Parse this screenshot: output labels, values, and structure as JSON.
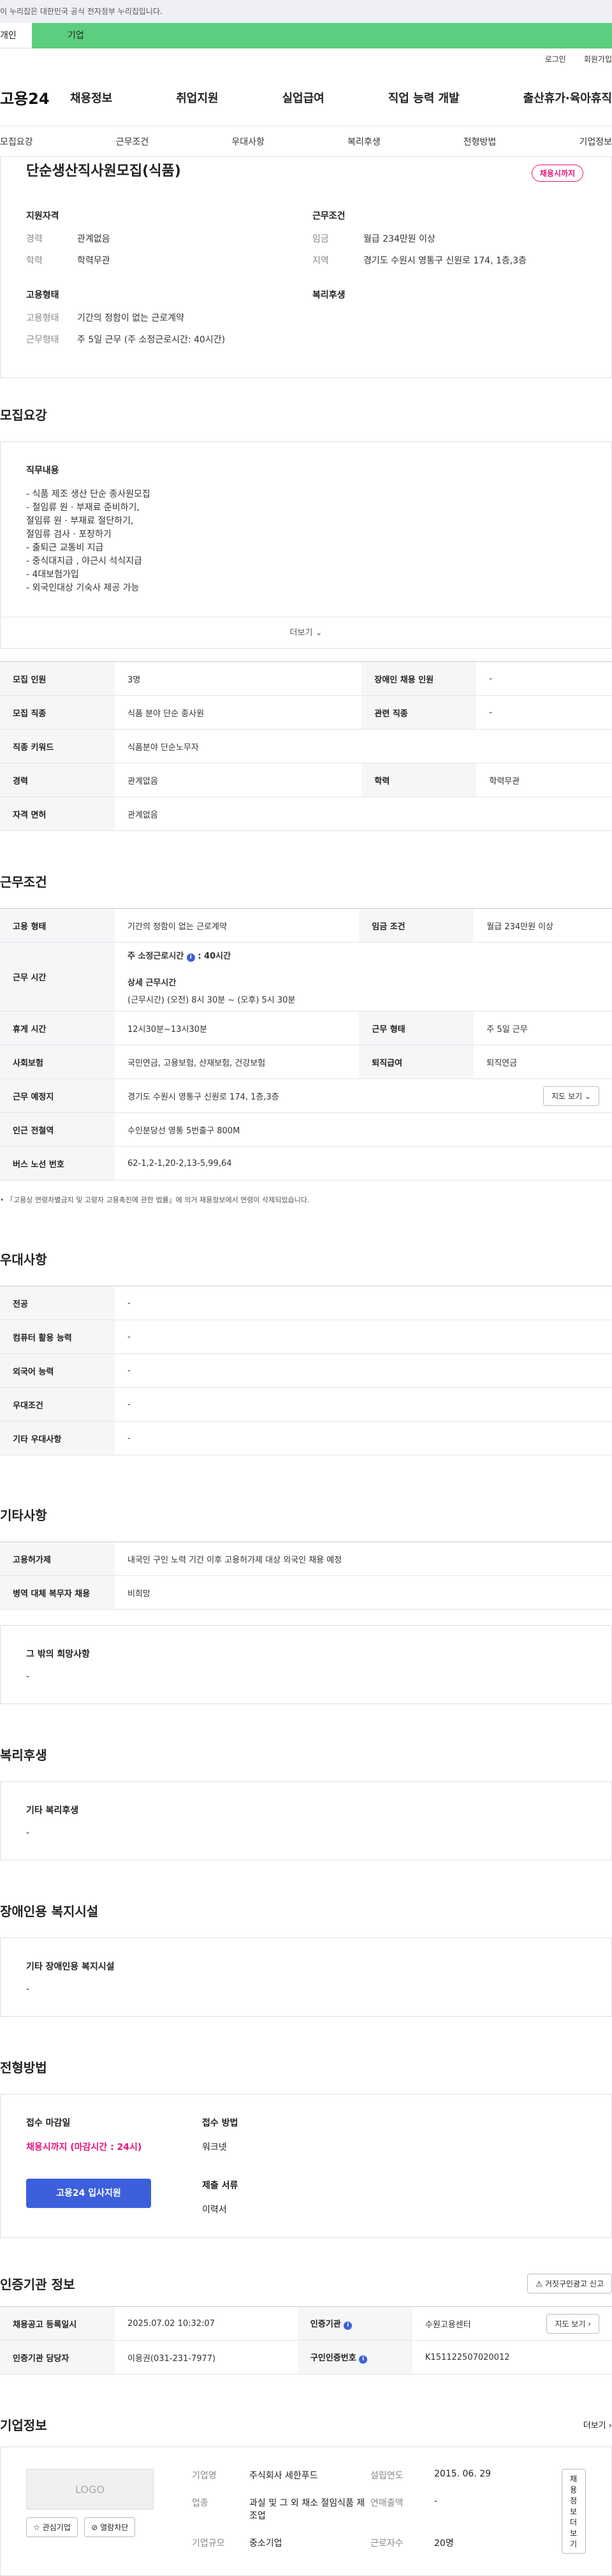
{
  "gov_banner": "이 누리집은 대한민국 공식 전자정부 누리집입니다.",
  "top_tabs": {
    "personal": "개인",
    "company": "기업"
  },
  "util": {
    "login": "로그인",
    "join": "회원가입"
  },
  "gnb": {
    "logo": "고용24",
    "menu": [
      "채용정보",
      "취업지원",
      "실업급여",
      "직업 능력 개발",
      "출산휴가·육아휴직"
    ]
  },
  "subnav": [
    "모집요강",
    "근무조건",
    "우대사항",
    "복리후생",
    "전형방법",
    "기업정보"
  ],
  "summary": {
    "title": "단순생산직사원모집(식품)",
    "badge": "채용시까지",
    "qual_title": "지원자격",
    "qual": [
      {
        "k": "경력",
        "v": "관계없음"
      },
      {
        "k": "학력",
        "v": "학력무관"
      }
    ],
    "cond_title": "근무조건",
    "cond": [
      {
        "k": "임금",
        "v": "월급 234만원 이상"
      },
      {
        "k": "지역",
        "v": "경기도 수원시 영통구 신원로 174, 1층,3층"
      }
    ],
    "emp_title": "고용형태",
    "emp": [
      {
        "k": "고용형태",
        "v": "기간의 정함이 없는 근로계약"
      },
      {
        "k": "근무형태",
        "v": "주 5일 근무 (주 소정근로시간: 40시간)"
      }
    ],
    "welfare_title": "복리후생"
  },
  "recruit": {
    "title": "모집요강",
    "duty_title": "직무내용",
    "duty_text": "- 식품 제조 생산 단순 종사원모집\n- 절임류 원 · 부재료 준비하기,\n  절임류 원 · 부재료 절단하기,\n  절임류 검사 · 포장하기\n- 출퇴근 교통비 지급\n- 중식대지급 , 야근시 석식지급\n- 4대보험가입\n- 외국인대상 기숙사 제공 가능",
    "more": "더보기",
    "table": [
      {
        "k1": "모집 인원",
        "v1": "3명",
        "k2": "장애인 채용 인원",
        "v2": "-"
      },
      {
        "k1": "모집 직종",
        "v1": "식품 분야 단순 종사원",
        "k2": "관련 직종",
        "v2": "-"
      },
      {
        "k1": "직종 키워드",
        "v1": "식품분야 단순노무자"
      },
      {
        "k1": "경력",
        "v1": "관계없음",
        "k2": "학력",
        "v2": "학력무관"
      },
      {
        "k1": "자격 면허",
        "v1": "관계없음"
      }
    ]
  },
  "work": {
    "title": "근무조건",
    "emp_k": "고용 형태",
    "emp_v": "기간의 정함이 없는 근로계약",
    "wage_k": "임금 조건",
    "wage_v": "월급 234만원 이상",
    "time_k": "근무 시간",
    "time_main": "주 소정근로시간",
    "time_main_v": ": 40시간",
    "time_detail_title": "상세 근무시간",
    "time_detail": "(근무시간) (오전) 8시 30분 ~ (오후) 5시 30분",
    "rest_k": "휴게 시간",
    "rest_v": "12시30분~13시30분",
    "form_k": "근무 형태",
    "form_v": "주 5일 근무",
    "ins_k": "사회보험",
    "ins_v": "국민연금, 고용보험, 산재보험, 건강보험",
    "ret_k": "퇴직급여",
    "ret_v": "퇴직연금",
    "place_k": "근무 예정지",
    "place_v": "경기도 수원시 영통구 신원로 174, 1층,3층",
    "map": "지도 보기",
    "station_k": "인근 전철역",
    "station_v": "수인분당선 영통 5번출구 800M",
    "bus_k": "버스 노선 번호",
    "bus_v": "62-1,2-1,20-2,13-5,99,64",
    "note": "「고용상 연령차별금지 및 고령자 고용촉진에 관한 법률」에 의거 채용정보에서 연령이 삭제되었습니다."
  },
  "pref": {
    "title": "우대사항",
    "rows": [
      {
        "k": "전공",
        "v": "-"
      },
      {
        "k": "컴퓨터 활용 능력",
        "v": "-"
      },
      {
        "k": "외국어 능력",
        "v": "-"
      },
      {
        "k": "우대조건",
        "v": "-"
      },
      {
        "k": "기타 우대사항",
        "v": "-"
      }
    ]
  },
  "etc": {
    "title": "기타사항",
    "rows": [
      {
        "k": "고용허가제",
        "v": "내국인 구인 노력 기간 이후 고용허가제 대상 외국인 채용 예정"
      },
      {
        "k": "병역 대체 복무자 채용",
        "v": "비희망"
      }
    ],
    "other_title": "그 밖의 희망사항",
    "other_v": "-"
  },
  "welfare": {
    "title": "복리후생",
    "box_title": "기타 복리후생",
    "v": "-"
  },
  "disability": {
    "title": "장애인용 복지시설",
    "box_title": "기타 장애인용 복지시설",
    "v": "-"
  },
  "selection": {
    "title": "전형방법",
    "deadline_k": "접수 마감일",
    "deadline_v": "채용시까지 (마감시간 : 24시)",
    "apply": "고용24 입사지원",
    "method_k": "접수 방법",
    "method_v": "워크넷",
    "docs_k": "제출 서류",
    "docs_v": "이력서"
  },
  "cert": {
    "title": "인증기관 정보",
    "report_btn": "거짓구인광고 신고",
    "rows": [
      {
        "k1": "채용공고 등록일시",
        "v1": "2025.07.02 10:32:07",
        "k2": "인증기관",
        "v2": "수원고용센터"
      },
      {
        "k1": "인증기관 담당자",
        "v1": "이용권(031-231-7977)",
        "k2": "구인인증번호",
        "v2": "K151122507020012"
      }
    ],
    "map": "지도 보기"
  },
  "company": {
    "title": "기업정보",
    "more": "더보기",
    "logo": "LOGO",
    "fav": "관심기업",
    "block": "열람차단",
    "fields": [
      {
        "k": "기업명",
        "v": "주식회사 세한푸드"
      },
      {
        "k": "업종",
        "v": "과실 및 그 외 채소 절임식품 제조업"
      },
      {
        "k": "기업규모",
        "v": "중소기업"
      }
    ],
    "fields2": [
      {
        "k": "설립연도",
        "v": "2015. 06. 29"
      },
      {
        "k": "연매출액",
        "v": "-"
      },
      {
        "k": "근로자수",
        "v": "20명"
      }
    ],
    "list_btn": "채용정보 더보기"
  }
}
